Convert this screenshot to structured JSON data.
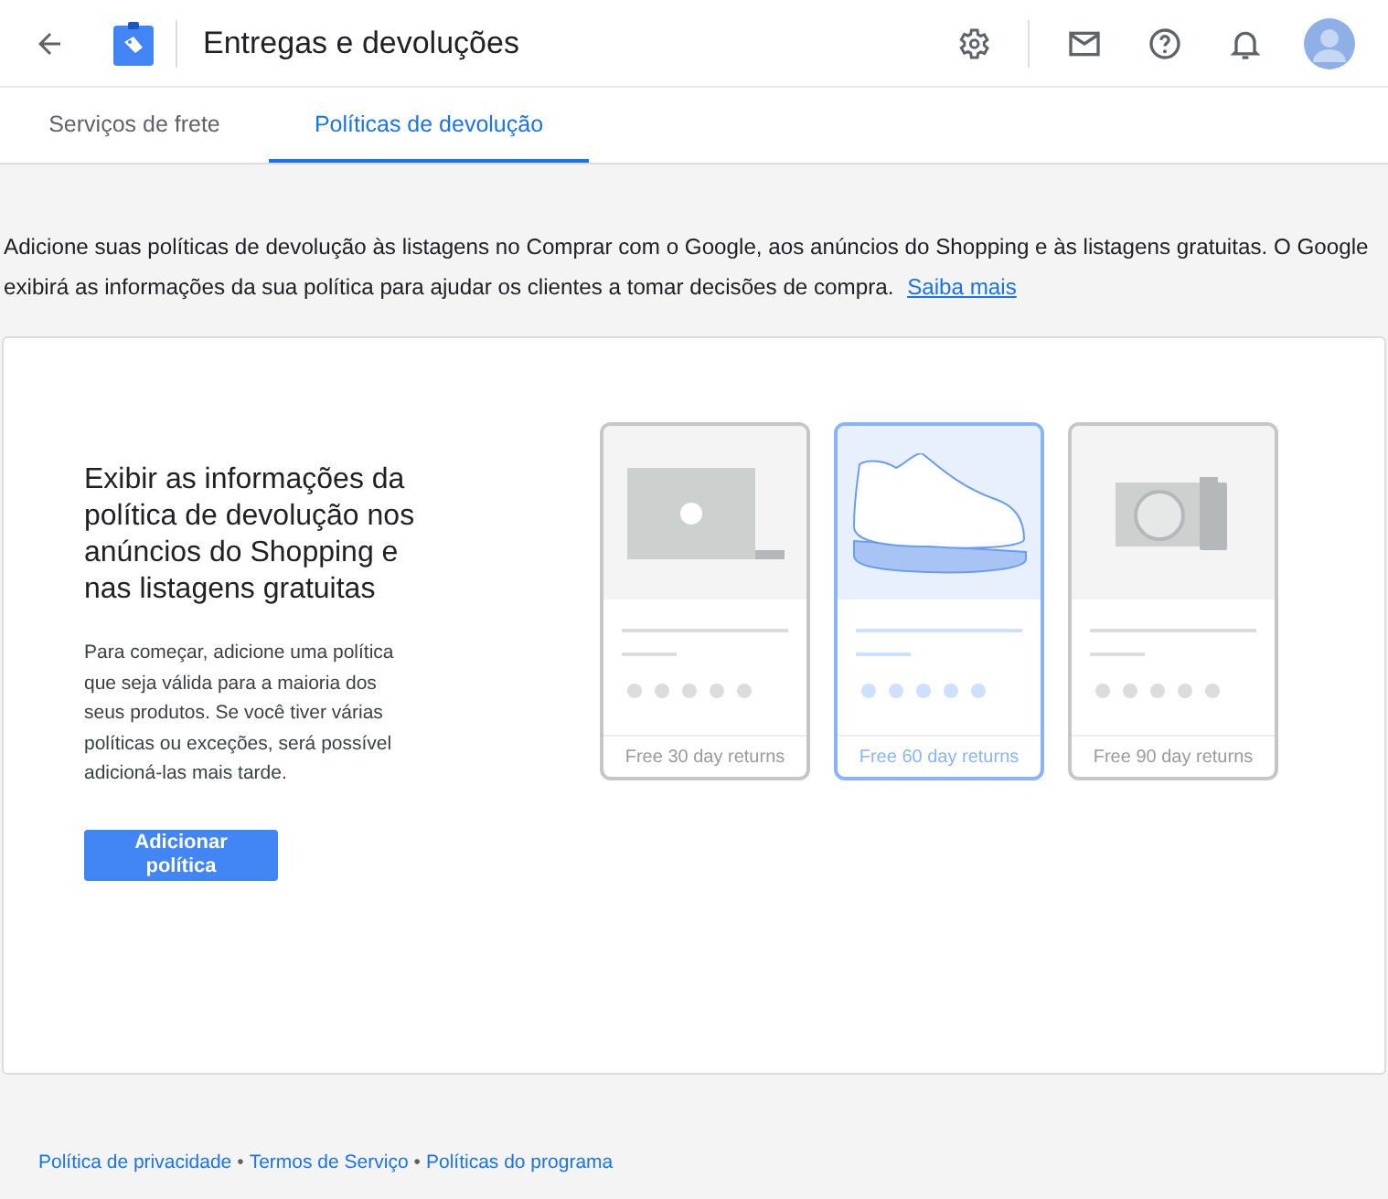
{
  "header": {
    "title": "Entregas e devoluções"
  },
  "tabs": [
    {
      "label": "Serviços de frete",
      "selected": false
    },
    {
      "label": "Políticas de devolução",
      "selected": true
    }
  ],
  "intro": {
    "text": "Adicione suas políticas de devolução às listagens no Comprar com o Google, aos anúncios do Shopping e às listagens gratuitas. O Google exibirá as informações da sua política para ajudar os clientes a tomar decisões de compra.",
    "link": "Saiba mais"
  },
  "panel": {
    "heading": "Exibir as informações da política de devolução nos anúncios do Shopping e nas listagens gratuitas",
    "body": "Para começar, adicione uma política que seja válida para a maioria dos seus produtos. Se você tiver várias políticas ou exceções, será possível adicioná-las mais tarde.",
    "button": "Adicionar política"
  },
  "examples": [
    {
      "kind": "laptop",
      "caption": "Free 30 day returns",
      "selected": false
    },
    {
      "kind": "shoe",
      "caption": "Free 60 day returns",
      "selected": true
    },
    {
      "kind": "camera",
      "caption": "Free 90 day returns",
      "selected": false
    }
  ],
  "footer": [
    {
      "kind": "link",
      "text": "Política de privacidade"
    },
    {
      "kind": "separator",
      "text": "•"
    },
    {
      "kind": "link",
      "text": "Termos de Serviço"
    },
    {
      "kind": "separator",
      "text": "•"
    },
    {
      "kind": "link",
      "text": "Políticas do programa"
    }
  ]
}
